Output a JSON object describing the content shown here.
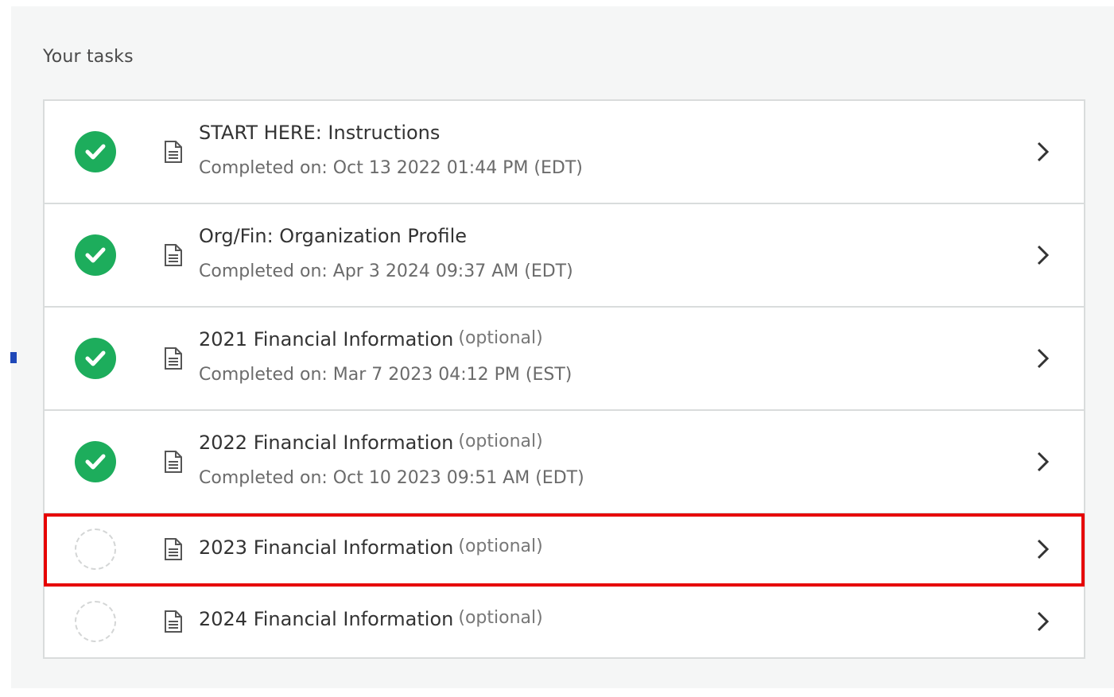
{
  "section_title": "Your tasks",
  "colors": {
    "completed": "#1dad5c",
    "highlight_outline": "#e60000"
  },
  "icons": {
    "status_done": "check-circle-icon",
    "status_todo": "empty-circle-icon",
    "document": "document-icon",
    "open": "chevron-right-icon"
  },
  "tasks": [
    {
      "title": "START HERE: Instructions",
      "optional": "",
      "status": "completed",
      "completed_text": "Completed on: Oct 13 2022 01:44 PM (EDT)"
    },
    {
      "title": "Org/Fin: Organization Profile",
      "optional": "",
      "status": "completed",
      "completed_text": "Completed on: Apr 3 2024 09:37 AM (EDT)"
    },
    {
      "title": "2021 Financial Information",
      "optional": "(optional)",
      "status": "completed",
      "completed_text": "Completed on: Mar 7 2023 04:12 PM (EST)"
    },
    {
      "title": "2022 Financial Information",
      "optional": "(optional)",
      "status": "completed",
      "completed_text": "Completed on: Oct 10 2023 09:51 AM (EDT)"
    },
    {
      "title": "2023 Financial Information",
      "optional": "(optional)",
      "status": "not-started",
      "completed_text": ""
    },
    {
      "title": "2024 Financial Information",
      "optional": "(optional)",
      "status": "not-started",
      "completed_text": ""
    }
  ]
}
